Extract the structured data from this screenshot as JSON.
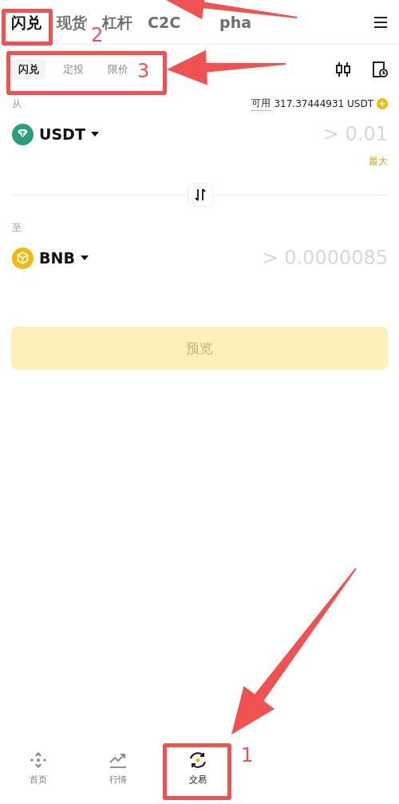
{
  "top_tabs": [
    {
      "label": "闪兑",
      "selected": true
    },
    {
      "label": "现货",
      "selected": false
    },
    {
      "label": "杠杆",
      "selected": false
    },
    {
      "label": "C2C",
      "selected": false
    },
    {
      "label": "pha",
      "selected": false
    }
  ],
  "sub_tabs": [
    {
      "label": "闪兑",
      "selected": true
    },
    {
      "label": "定投",
      "selected": false
    },
    {
      "label": "限价",
      "selected": false
    }
  ],
  "from": {
    "label": "从",
    "balance_label": "可用",
    "balance": "317.37444931 USDT",
    "token": "USDT",
    "amount_placeholder": "> 0.01",
    "max": "最大"
  },
  "to": {
    "label": "至",
    "token": "BNB",
    "amount_placeholder": "> 0.0000085"
  },
  "preview_button": {
    "label": "预览",
    "disabled": true
  },
  "bottom_nav": [
    {
      "label": "首页",
      "selected": false
    },
    {
      "label": "行情",
      "selected": false
    },
    {
      "label": "交易",
      "selected": true
    }
  ],
  "annotation_numbers": [
    "2",
    "3",
    "1"
  ]
}
